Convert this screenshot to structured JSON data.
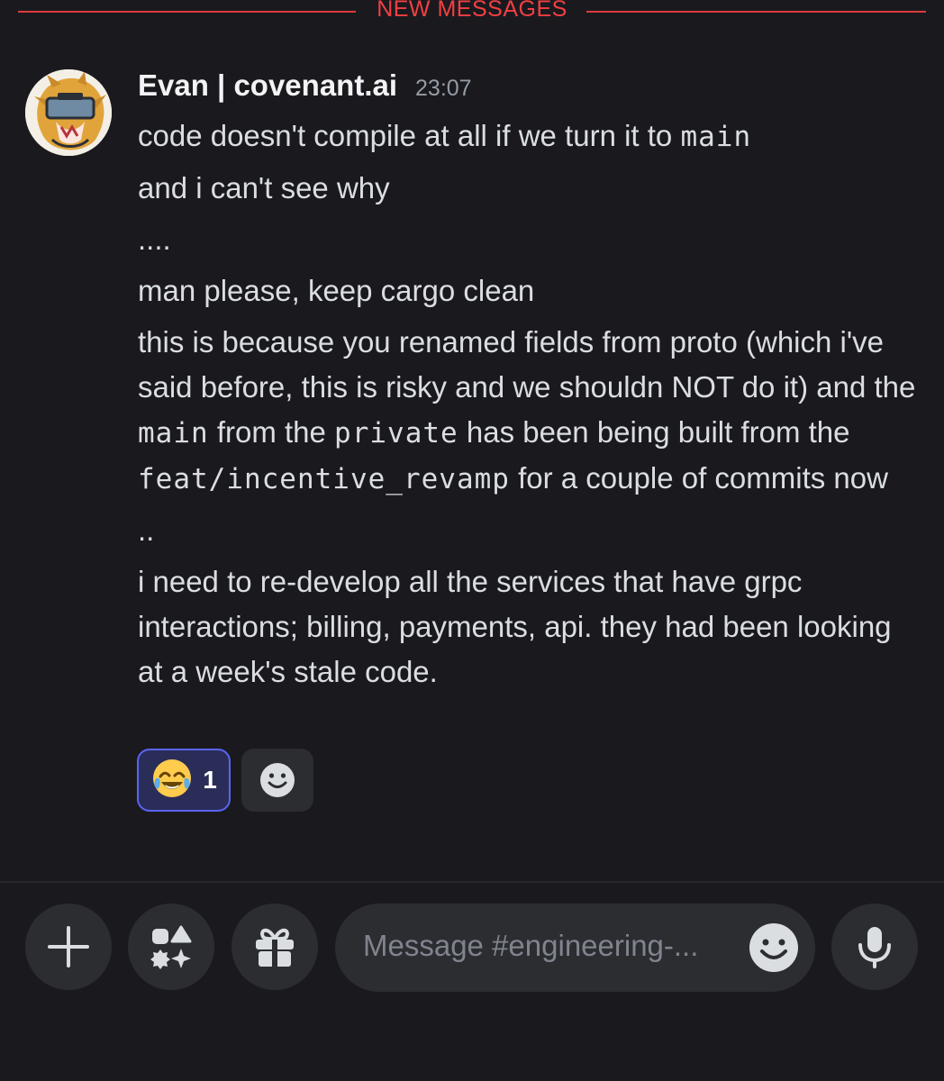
{
  "divider": {
    "label": "NEW MESSAGES"
  },
  "message": {
    "author": "Evan | covenant.ai",
    "timestamp": "23:07",
    "lines": [
      [
        {
          "t": "code doesn't compile at all if we turn it to "
        },
        {
          "t": "main",
          "code": true
        }
      ],
      [
        {
          "t": "and i can't see why"
        }
      ],
      [
        {
          "t": "...."
        }
      ],
      [
        {
          "t": "man please, keep cargo clean"
        }
      ],
      [
        {
          "t": "this is because you renamed fields from proto (which i've said before, this is risky and we shouldn NOT do it) and the "
        },
        {
          "t": "main",
          "code": true
        },
        {
          "t": " from the "
        },
        {
          "t": "private",
          "code": true
        },
        {
          "t": " has been being built from the "
        },
        {
          "t": "feat/incentive_revamp",
          "code": true
        },
        {
          "t": " for a couple of commits now"
        }
      ],
      [
        {
          "t": ".."
        }
      ],
      [
        {
          "t": "i need to re-develop all the services that have grpc interactions; billing, payments, api. they had been looking at a week's stale code."
        }
      ]
    ],
    "reactions": [
      {
        "emoji": "😂",
        "count": "1",
        "selected": true
      }
    ]
  },
  "composer": {
    "placeholder": "Message #engineering-...",
    "buttons": [
      "plus-icon",
      "apps-icon",
      "gift-icon",
      "emoji-icon",
      "microphone-icon"
    ]
  },
  "colors": {
    "background": "#1a1a1e",
    "new_messages": "#f23f43",
    "reaction_bg": "#2b2d59",
    "reaction_border": "#5865f2",
    "button_bg": "#2b2d31"
  }
}
